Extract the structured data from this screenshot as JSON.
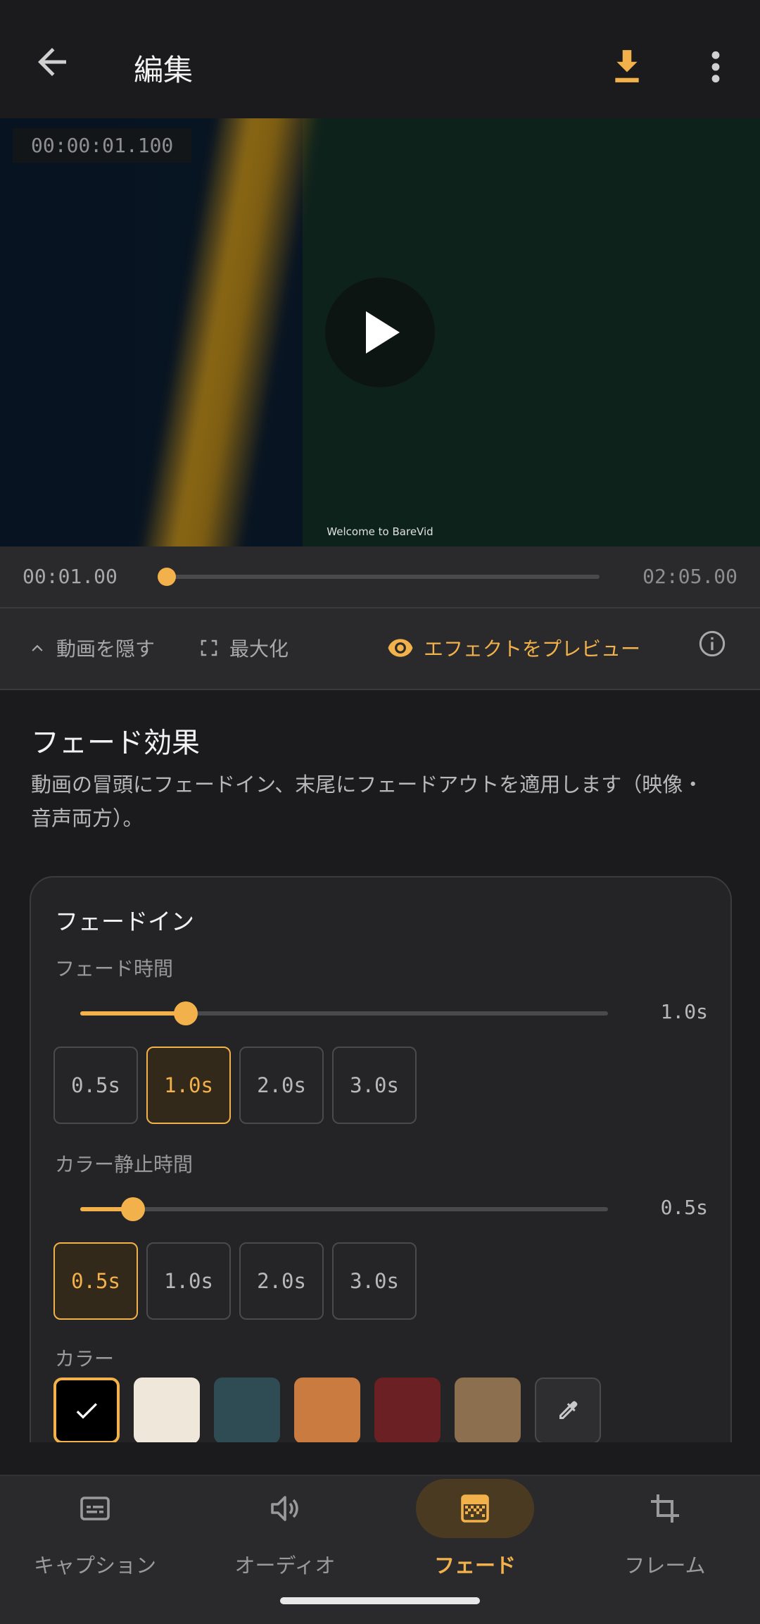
{
  "appbar": {
    "title": "編集"
  },
  "video": {
    "timestamp": "00:00:01.100",
    "caption": "Welcome to BareVid"
  },
  "timeline": {
    "current": "00:01.00",
    "duration": "02:05.00",
    "progress": 0.008
  },
  "controls": {
    "hide_video": "動画を隠す",
    "maximize": "最大化",
    "preview_effect": "エフェクトをプレビュー"
  },
  "section": {
    "title": "フェード効果",
    "description": "動画の冒頭にフェードイン、末尾にフェードアウトを適用します（映像・音声両方）。"
  },
  "fade_in": {
    "title": "フェードイン",
    "duration": {
      "label": "フェード時間",
      "value": "1.0s",
      "fraction": 0.2,
      "options": [
        "0.5s",
        "1.0s",
        "2.0s",
        "3.0s"
      ],
      "selected": 1
    },
    "hold": {
      "label": "カラー静止時間",
      "value": "0.5s",
      "fraction": 0.1,
      "options": [
        "0.5s",
        "1.0s",
        "2.0s",
        "3.0s"
      ],
      "selected": 0
    },
    "color": {
      "label": "カラー",
      "swatches": [
        "#000000",
        "#efe8da",
        "#2f4b54",
        "#c97b40",
        "#6b2023",
        "#8b6f4e"
      ],
      "selected": 0
    }
  },
  "nav": {
    "tabs": [
      {
        "label": "キャプション",
        "icon": "subtitles-icon"
      },
      {
        "label": "オーディオ",
        "icon": "volume-icon"
      },
      {
        "label": "フェード",
        "icon": "gradient-icon"
      },
      {
        "label": "フレーム",
        "icon": "crop-icon"
      }
    ],
    "active": 2
  },
  "colors": {
    "accent": "#f2b14a",
    "background": "#1b1b1d"
  }
}
